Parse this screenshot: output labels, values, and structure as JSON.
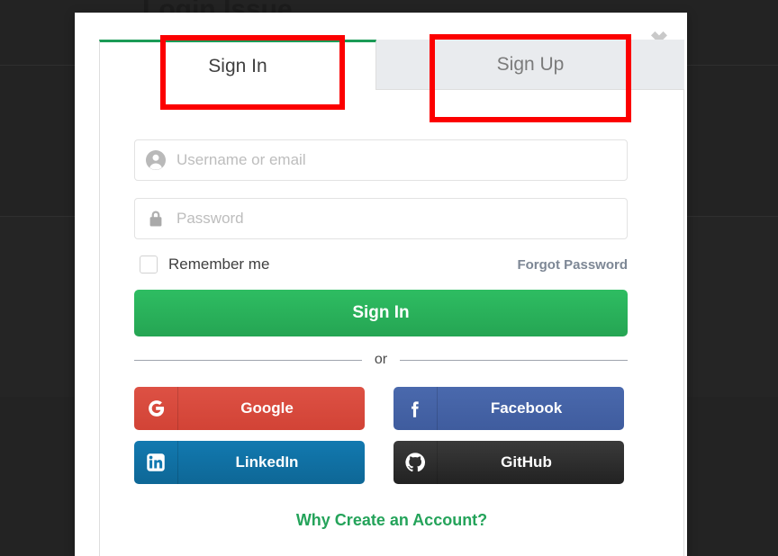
{
  "background_page": {
    "heading": "Login Issue"
  },
  "modal": {
    "close_icon_label": "✖",
    "tabs": [
      {
        "label": "Sign In",
        "state": "active"
      },
      {
        "label": "Sign Up",
        "state": "inactive"
      }
    ],
    "form": {
      "username": {
        "placeholder": "Username or email",
        "value": "",
        "icon": "user-icon"
      },
      "password": {
        "placeholder": "Password",
        "value": "",
        "icon": "lock-icon"
      },
      "remember_me_label": "Remember me",
      "remember_me_checked": false,
      "forgot_password_label": "Forgot Password",
      "submit_label": "Sign In"
    },
    "divider_label": "or",
    "social_buttons": [
      {
        "label": "Google",
        "icon": "google-icon",
        "color": "#d24336"
      },
      {
        "label": "Facebook",
        "icon": "facebook-icon",
        "color": "#3f5c9e"
      },
      {
        "label": "LinkedIn",
        "icon": "linkedin-icon",
        "color": "#0e6796"
      },
      {
        "label": "GitHub",
        "icon": "github-icon",
        "color": "#222222"
      }
    ],
    "footer_link_label": "Why Create an Account?"
  },
  "annotations": {
    "color": "#fc0000",
    "boxes": [
      {
        "target": "Sign In tab"
      },
      {
        "target": "Sign Up tab"
      }
    ]
  },
  "theme": {
    "accent_green": "#24a35a",
    "active_tab_border": "#1b9b56",
    "inactive_tab_bg": "#e9ebee",
    "backdrop": "#232323"
  }
}
